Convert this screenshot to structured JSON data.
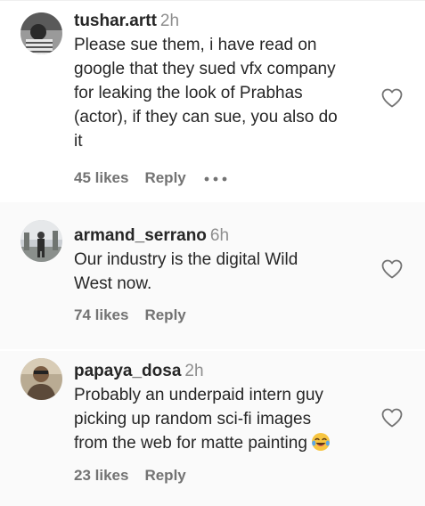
{
  "comments": [
    {
      "username": "tushar.artt",
      "time": "2h",
      "lines": [
        "Please sue them, i have read on",
        "google that they sued vfx company",
        "for leaking the look of Prabhas",
        "(actor), if they can sue, you also do",
        "it"
      ],
      "likes": "45 likes",
      "reply": "Reply",
      "has_more_menu": true,
      "avatar_icon": "avatar-photo"
    },
    {
      "username": "armand_serrano",
      "time": "6h",
      "lines": [
        "Our industry is the digital Wild",
        "West now."
      ],
      "likes": "74 likes",
      "reply": "Reply",
      "has_more_menu": false,
      "avatar_icon": "avatar-photo"
    },
    {
      "username": "papaya_dosa",
      "time": "2h",
      "lines": [
        "Probably an underpaid intern guy",
        "picking up random sci-fi images",
        "from the web for matte painting"
      ],
      "trailing_emoji": "😂",
      "likes": "23 likes",
      "reply": "Reply",
      "has_more_menu": false,
      "avatar_icon": "avatar-photo"
    }
  ],
  "icons": {
    "like": "heart-outline-icon",
    "more": "more-horizontal-icon"
  },
  "colors": {
    "text": "#262626",
    "muted": "#8e8e8e",
    "meta": "#737373",
    "alt_background": "#fafafa"
  }
}
